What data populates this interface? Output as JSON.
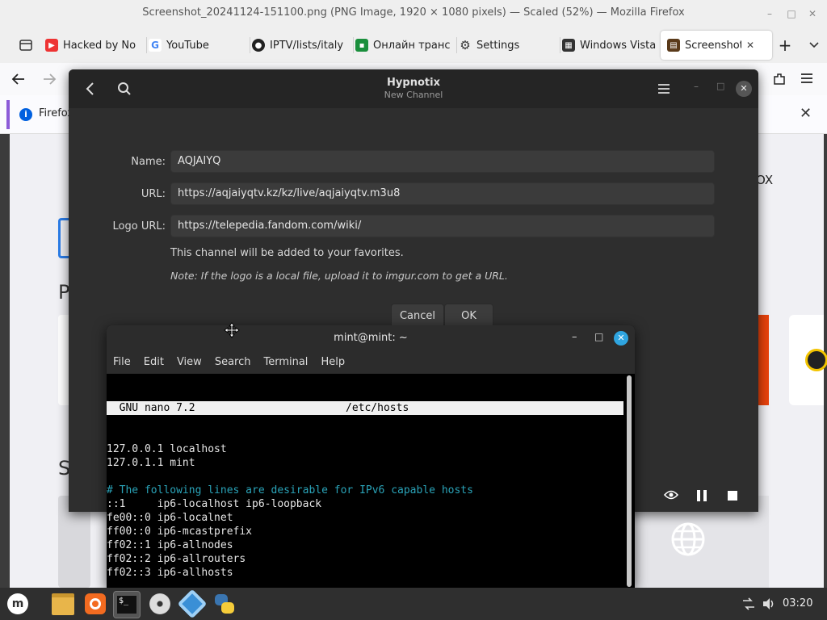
{
  "firefox": {
    "title": "Screenshot_20241124-151100.png (PNG Image, 1920 × 1080 pixels) — Scaled (52%) — Mozilla Firefox",
    "tabs": [
      {
        "label": "Hacked by Nо",
        "icon": "youtube-icon"
      },
      {
        "label": "YouTube",
        "icon": "google-icon"
      },
      {
        "label": "IPTV/lists/italy",
        "icon": "github-icon"
      },
      {
        "label": "Онлайн транс",
        "icon": "tv-icon"
      },
      {
        "label": "Settings",
        "icon": "gear-icon"
      },
      {
        "label": "Windows Vista",
        "icon": "windows-icon"
      },
      {
        "label": "Screenshot",
        "icon": "image-icon"
      }
    ],
    "notice": "Firefox",
    "colors": {
      "notice_accent": "#8c5bd8",
      "active_tab": "#ffffff"
    }
  },
  "background_page": {
    "fragments": [
      "OX",
      "P",
      "S"
    ]
  },
  "hypnotix": {
    "title": "Hypnotix",
    "subtitle": "New Channel",
    "fields": [
      {
        "label": "Name:",
        "value": "AQJAIYQ"
      },
      {
        "label": "URL:",
        "value": "https://aqjaiyqtv.kz/kz/live/aqjaiyqtv.m3u8"
      },
      {
        "label": "Logo URL:",
        "value": "https://telepedia.fandom.com/wiki/"
      }
    ],
    "info": "This channel will be added to your favorites.",
    "note": "Note: If the logo is a local file, upload it to imgur.com to get a URL.",
    "cancel": "Cancel",
    "ok": "OK"
  },
  "terminal": {
    "title": "mint@mint: ~",
    "menu": [
      "File",
      "Edit",
      "View",
      "Search",
      "Terminal",
      "Help"
    ],
    "nano_version": "  GNU nano 7.2",
    "nano_file": "/etc/hosts",
    "lines": [
      {
        "text": "127.0.0.1 localhost",
        "type": "normal"
      },
      {
        "text": "127.0.1.1 mint",
        "type": "normal"
      },
      {
        "text": "",
        "type": "normal"
      },
      {
        "text": "# The following lines are desirable for IPv6 capable hosts",
        "type": "comment"
      },
      {
        "text": "::1     ip6-localhost ip6-loopback",
        "type": "normal"
      },
      {
        "text": "fe00::0 ip6-localnet",
        "type": "normal"
      },
      {
        "text": "ff00::0 ip6-mcastprefix",
        "type": "normal"
      },
      {
        "text": "ff02::1 ip6-allnodes",
        "type": "normal"
      },
      {
        "text": "ff02::2 ip6-allrouters",
        "type": "normal"
      },
      {
        "text": "ff02::3 ip6-allhosts",
        "type": "normal"
      }
    ]
  },
  "taskbar": {
    "clock": "03:20",
    "apps": [
      "mint-menu-icon",
      "files-icon",
      "firefox-icon",
      "terminal-icon",
      "disc-icon",
      "hypnotix-icon",
      "python-icon"
    ]
  }
}
